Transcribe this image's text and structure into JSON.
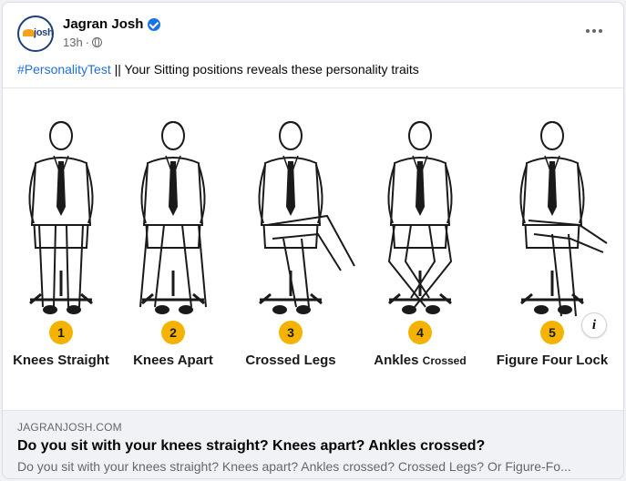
{
  "post": {
    "page_name": "Jagran Josh",
    "avatar_text": "josh",
    "time": "13h",
    "separator": "·",
    "hashtag": "#PersonalityTest",
    "caption": " || Your Sitting positions reveals these personality traits"
  },
  "image": {
    "positions": [
      {
        "number": "1",
        "label": "Knees Straight",
        "small": ""
      },
      {
        "number": "2",
        "label": "Knees Apart",
        "small": ""
      },
      {
        "number": "3",
        "label": "Crossed Legs",
        "small": ""
      },
      {
        "number": "4",
        "label": "Ankles ",
        "small": "Crossed"
      },
      {
        "number": "5",
        "label": "Figure Four Lock",
        "small": ""
      }
    ],
    "badge_color": "#f5b301"
  },
  "link_preview": {
    "domain": "JAGRANJOSH.COM",
    "title": "Do you sit with your knees straight? Knees apart? Ankles crossed?",
    "description": "Do you sit with your knees straight? Knees apart? Ankles crossed? Crossed Legs? Or Figure-Fo..."
  },
  "icons": {
    "verified": "verified-badge-icon",
    "audience": "globe-icon",
    "more": "more-options-icon",
    "info": "info-icon"
  }
}
